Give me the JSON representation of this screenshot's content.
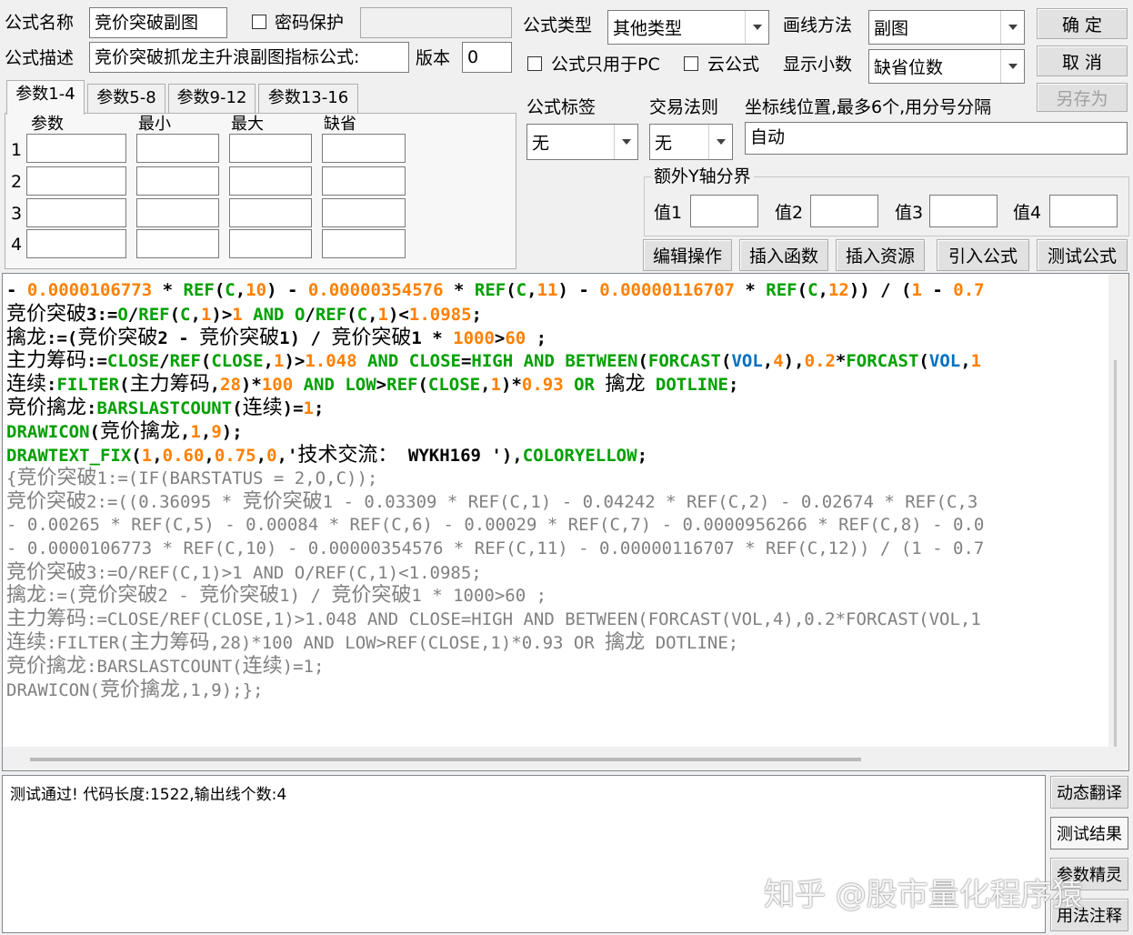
{
  "form": {
    "name_label": "公式名称",
    "name_value": "竞价突破副图",
    "password_label": "密码保护",
    "password_value": "",
    "desc_label": "公式描述",
    "desc_value": "竞价突破抓龙主升浪副图指标公式:",
    "version_label": "版本",
    "version_value": "0",
    "type_label": "公式类型",
    "type_value": "其他类型",
    "draw_label": "画线方法",
    "draw_value": "副图",
    "pc_only_label": "公式只用于PC",
    "cloud_label": "云公式",
    "decimal_label": "显示小数",
    "decimal_value": "缺省位数",
    "tag_label": "公式标签",
    "tag_value": "无",
    "trade_label": "交易法则",
    "trade_value": "无",
    "coord_label": "坐标线位置,最多6个,用分号分隔",
    "coord_value": "自动",
    "yaxis_group_label": "额外Y轴分界",
    "yaxis_values": [
      {
        "label": "值1",
        "value": ""
      },
      {
        "label": "值2",
        "value": ""
      },
      {
        "label": "值3",
        "value": ""
      },
      {
        "label": "值4",
        "value": ""
      }
    ]
  },
  "buttons": {
    "ok": "确 定",
    "cancel": "取 消",
    "save_as": "另存为",
    "edit": "编辑操作",
    "insert_func": "插入函数",
    "insert_res": "插入资源",
    "import_formula": "引入公式",
    "test_formula": "测试公式",
    "dynamic_translate": "动态翻译",
    "test_result": "测试结果",
    "param_wizard": "参数精灵",
    "usage_notes": "用法注释"
  },
  "params": {
    "tabs": [
      "参数1-4",
      "参数5-8",
      "参数9-12",
      "参数13-16"
    ],
    "headers": [
      "参数",
      "最小",
      "最大",
      "缺省"
    ],
    "rows": [
      "1",
      "2",
      "3",
      "4"
    ]
  },
  "code_lines": [
    "- 0.0000106773 * REF(C,10) - 0.00000354576 * REF(C,11) - 0.00000116707 * REF(C,12)) / (1 - 0.7",
    "竞价突破3:=O/REF(C,1)>1 AND O/REF(C,1)<1.0985;",
    "擒龙:=(竞价突破2 - 竞价突破1) / 竞价突破1 * 1000>60 ;",
    "主力筹码:=CLOSE/REF(CLOSE,1)>1.048 AND CLOSE=HIGH AND BETWEEN(FORCAST(VOL,4),0.2*FORCAST(VOL,1",
    "连续:FILTER(主力筹码,28)*100 AND LOW>REF(CLOSE,1)*0.93 OR 擒龙 DOTLINE;",
    "竞价擒龙:BARSLASTCOUNT(连续)=1;",
    "DRAWICON(竞价擒龙,1,9);",
    "DRAWTEXT_FIX(1,0.60,0.75,0,'技术交流: WYKH169 '),COLORYELLOW;",
    "{竞价突破1:=(IF(BARSTATUS = 2,O,C));",
    "竞价突破2:=((0.36095 * 竞价突破1 - 0.03309 * REF(C,1) - 0.04242 * REF(C,2) - 0.02674 * REF(C,3",
    "- 0.00265 * REF(C,5) - 0.00084 * REF(C,6) - 0.00029 * REF(C,7) - 0.0000956266 * REF(C,8) - 0.0",
    "- 0.0000106773 * REF(C,10) - 0.00000354576 * REF(C,11) - 0.00000116707 * REF(C,12)) / (1 - 0.7",
    "竞价突破3:=O/REF(C,1)>1 AND O/REF(C,1)<1.0985;",
    "擒龙:=(竞价突破2 - 竞价突破1) / 竞价突破1 * 1000>60 ;",
    "主力筹码:=CLOSE/REF(CLOSE,1)>1.048 AND CLOSE=HIGH AND BETWEEN(FORCAST(VOL,4),0.2*FORCAST(VOL,1",
    "连续:FILTER(主力筹码,28)*100 AND LOW>REF(CLOSE,1)*0.93 OR 擒龙 DOTLINE;",
    "竞价擒龙:BARSLASTCOUNT(连续)=1;",
    "DRAWICON(竞价擒龙,1,9);}"
  ],
  "output_text": "测试通过! 代码长度:1522,输出线个数:4",
  "watermark": "知乎 @股市量化程序猿",
  "colors": {
    "keyword_green": "#00a000",
    "number_orange": "#ff8000",
    "var_blue": "#0070c0",
    "comment_gray": "#808080"
  }
}
